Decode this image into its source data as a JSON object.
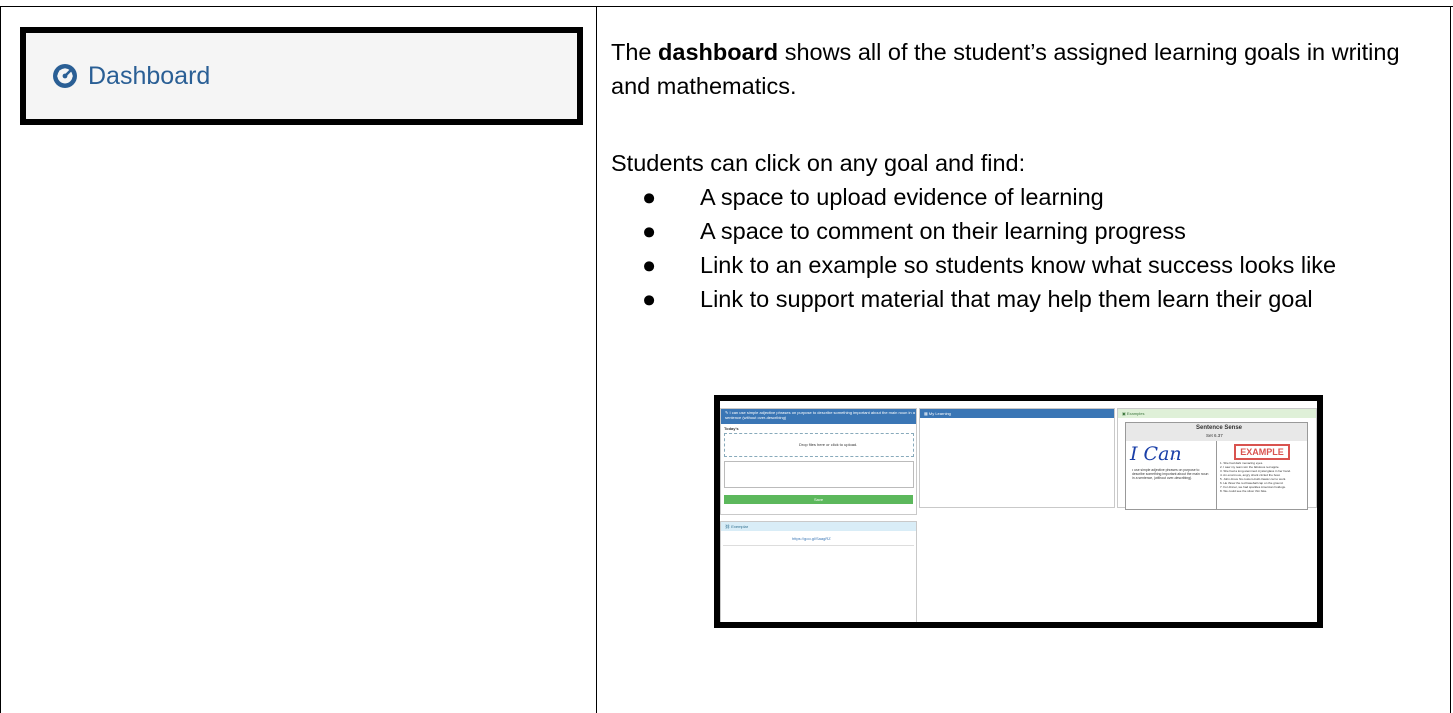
{
  "sidebar_item": {
    "icon": "dashboard-gauge-icon",
    "label": "Dashboard"
  },
  "description": {
    "p1_prefix": "The ",
    "p1_bold": "dashboard",
    "p1_suffix": " shows all of the student’s assigned learning goals in writing and mathematics.",
    "p2": "Students can click on any goal and find:",
    "bullets": [
      "A space to upload evidence of learning",
      "A space to comment on their learning progress",
      "Link to an example so students know what success looks like",
      "Link to support material that may help them learn their goal"
    ]
  },
  "screenshot": {
    "goal_header": "I can use simple adjective phrases on purpose to describe something important about the main noun in a sentence (without over-describing)",
    "today_label": "Today's",
    "drop_text": "Drop files here or click to upload.",
    "save_label": "Save",
    "my_learning_header": "My Learning",
    "examples_header": "Examples",
    "card_title": "Sentence Sense",
    "card_subtitle": "Set 6.37",
    "i_can": "I Can",
    "example_stamp": "EXAMPLE",
    "card_bullet": "use simple adjective phrases on purpose to describe something important about the main noun in a sentence, (without over-describing).",
    "example_lines": [
      "1. She had dark menacing eyes.",
      "2. I saw my team win the fabulous red apple.",
      "3. She had a long-stemmed crystal glass in her hand.",
      "4. An enormous, angry shark circled the boat.",
      "5. John drove his custom-built classic car to work.",
      "6. He threw the red baseball cap on the ground.",
      "7. For dinner, we had sparkles American hotdogs.",
      "8. We could see the silver thin bike."
    ],
    "exemplar_header": "Exemplar",
    "exemplar_link": "https://goo.gl/SaagRZ"
  }
}
